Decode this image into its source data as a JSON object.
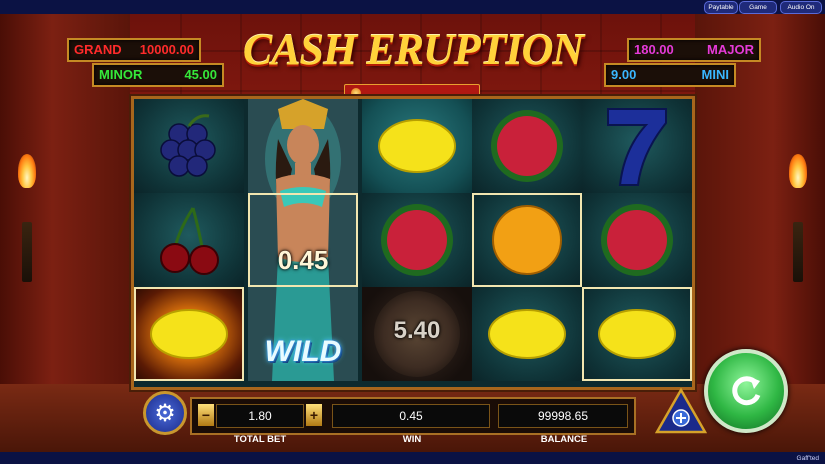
{
  "topbar": {
    "paytable": "Paytable",
    "game_rules": "Game Rules",
    "audio": "Audio On"
  },
  "brand": "Gaff'ted",
  "jackpots": {
    "grand": {
      "label": "GRAND",
      "value": "10000.00",
      "color": "#ff2b2b"
    },
    "minor": {
      "label": "MINOR",
      "value": "45.00",
      "color": "#35e83a"
    },
    "major": {
      "label": "MAJOR",
      "value": "180.00",
      "color": "#e53ad8"
    },
    "mini": {
      "label": "MINI",
      "value": "9.00",
      "color": "#3ab7ff"
    }
  },
  "logo": "CASH ERUPTION",
  "reels": {
    "grid": [
      [
        "plum-icon",
        "cherry-icon",
        "lemon-icon"
      ],
      [
        "wild-icon",
        "wild-icon",
        "wild-icon"
      ],
      [
        "lemon-icon",
        "watermelon-icon",
        "fireball-icon"
      ],
      [
        "watermelon-icon",
        "orange-icon",
        "lemon-icon"
      ],
      [
        "seven-icon",
        "watermelon-icon",
        "lemon-icon"
      ]
    ],
    "wild_label": "WILD",
    "wild_prize": "0.45",
    "fireball_prize": "5.40"
  },
  "controls": {
    "total_bet_value": "1.80",
    "total_bet_label": "TOTAL BET",
    "minus": "−",
    "plus": "+",
    "win_value": "0.45",
    "win_label": "WIN",
    "balance_value": "99998.65",
    "balance_label": "BALANCE"
  },
  "colors": {
    "frame": "#a8661c",
    "reel_bg": "#0f3337",
    "spin": "#2fb744"
  }
}
